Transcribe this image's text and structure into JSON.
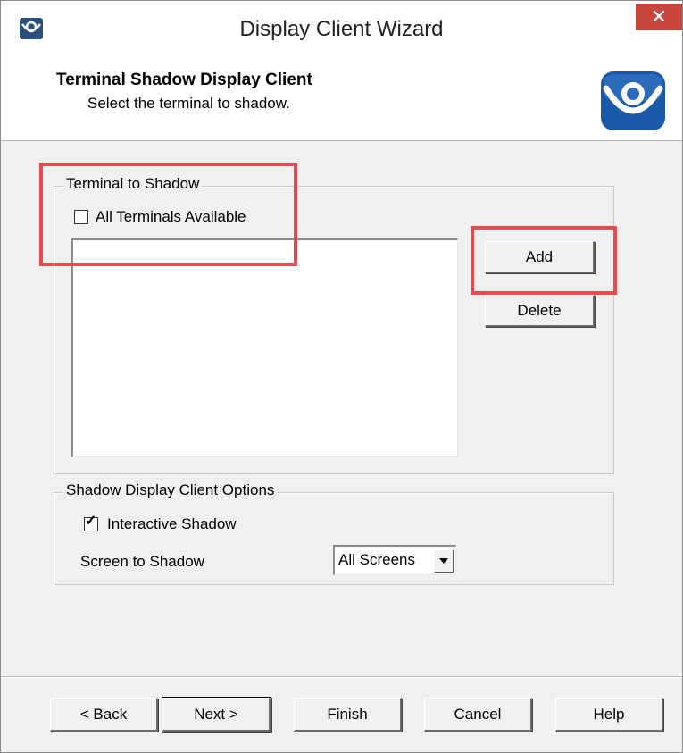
{
  "window": {
    "title": "Display Client Wizard",
    "close_glyph": "✕"
  },
  "header": {
    "title": "Terminal Shadow Display Client",
    "subtitle": "Select the terminal to shadow.",
    "logo_icon": "thinmanager-logo-icon"
  },
  "terminal_group": {
    "legend": "Terminal to Shadow",
    "all_terminals_label": "All Terminals Available",
    "all_terminals_checked": false,
    "terminals": [],
    "add_label": "Add",
    "delete_label": "Delete"
  },
  "options_group": {
    "legend": "Shadow Display Client Options",
    "interactive_label": "Interactive Shadow",
    "interactive_checked": true,
    "screen_label": "Screen to Shadow",
    "screen_value": "All Screens"
  },
  "footer": {
    "back_label": "< Back",
    "next_label": "Next >",
    "finish_label": "Finish",
    "cancel_label": "Cancel",
    "help_label": "Help"
  },
  "colors": {
    "highlight": "#e84a4f",
    "close_button": "#c6453c",
    "logo_blue": "#1a5aa8"
  }
}
